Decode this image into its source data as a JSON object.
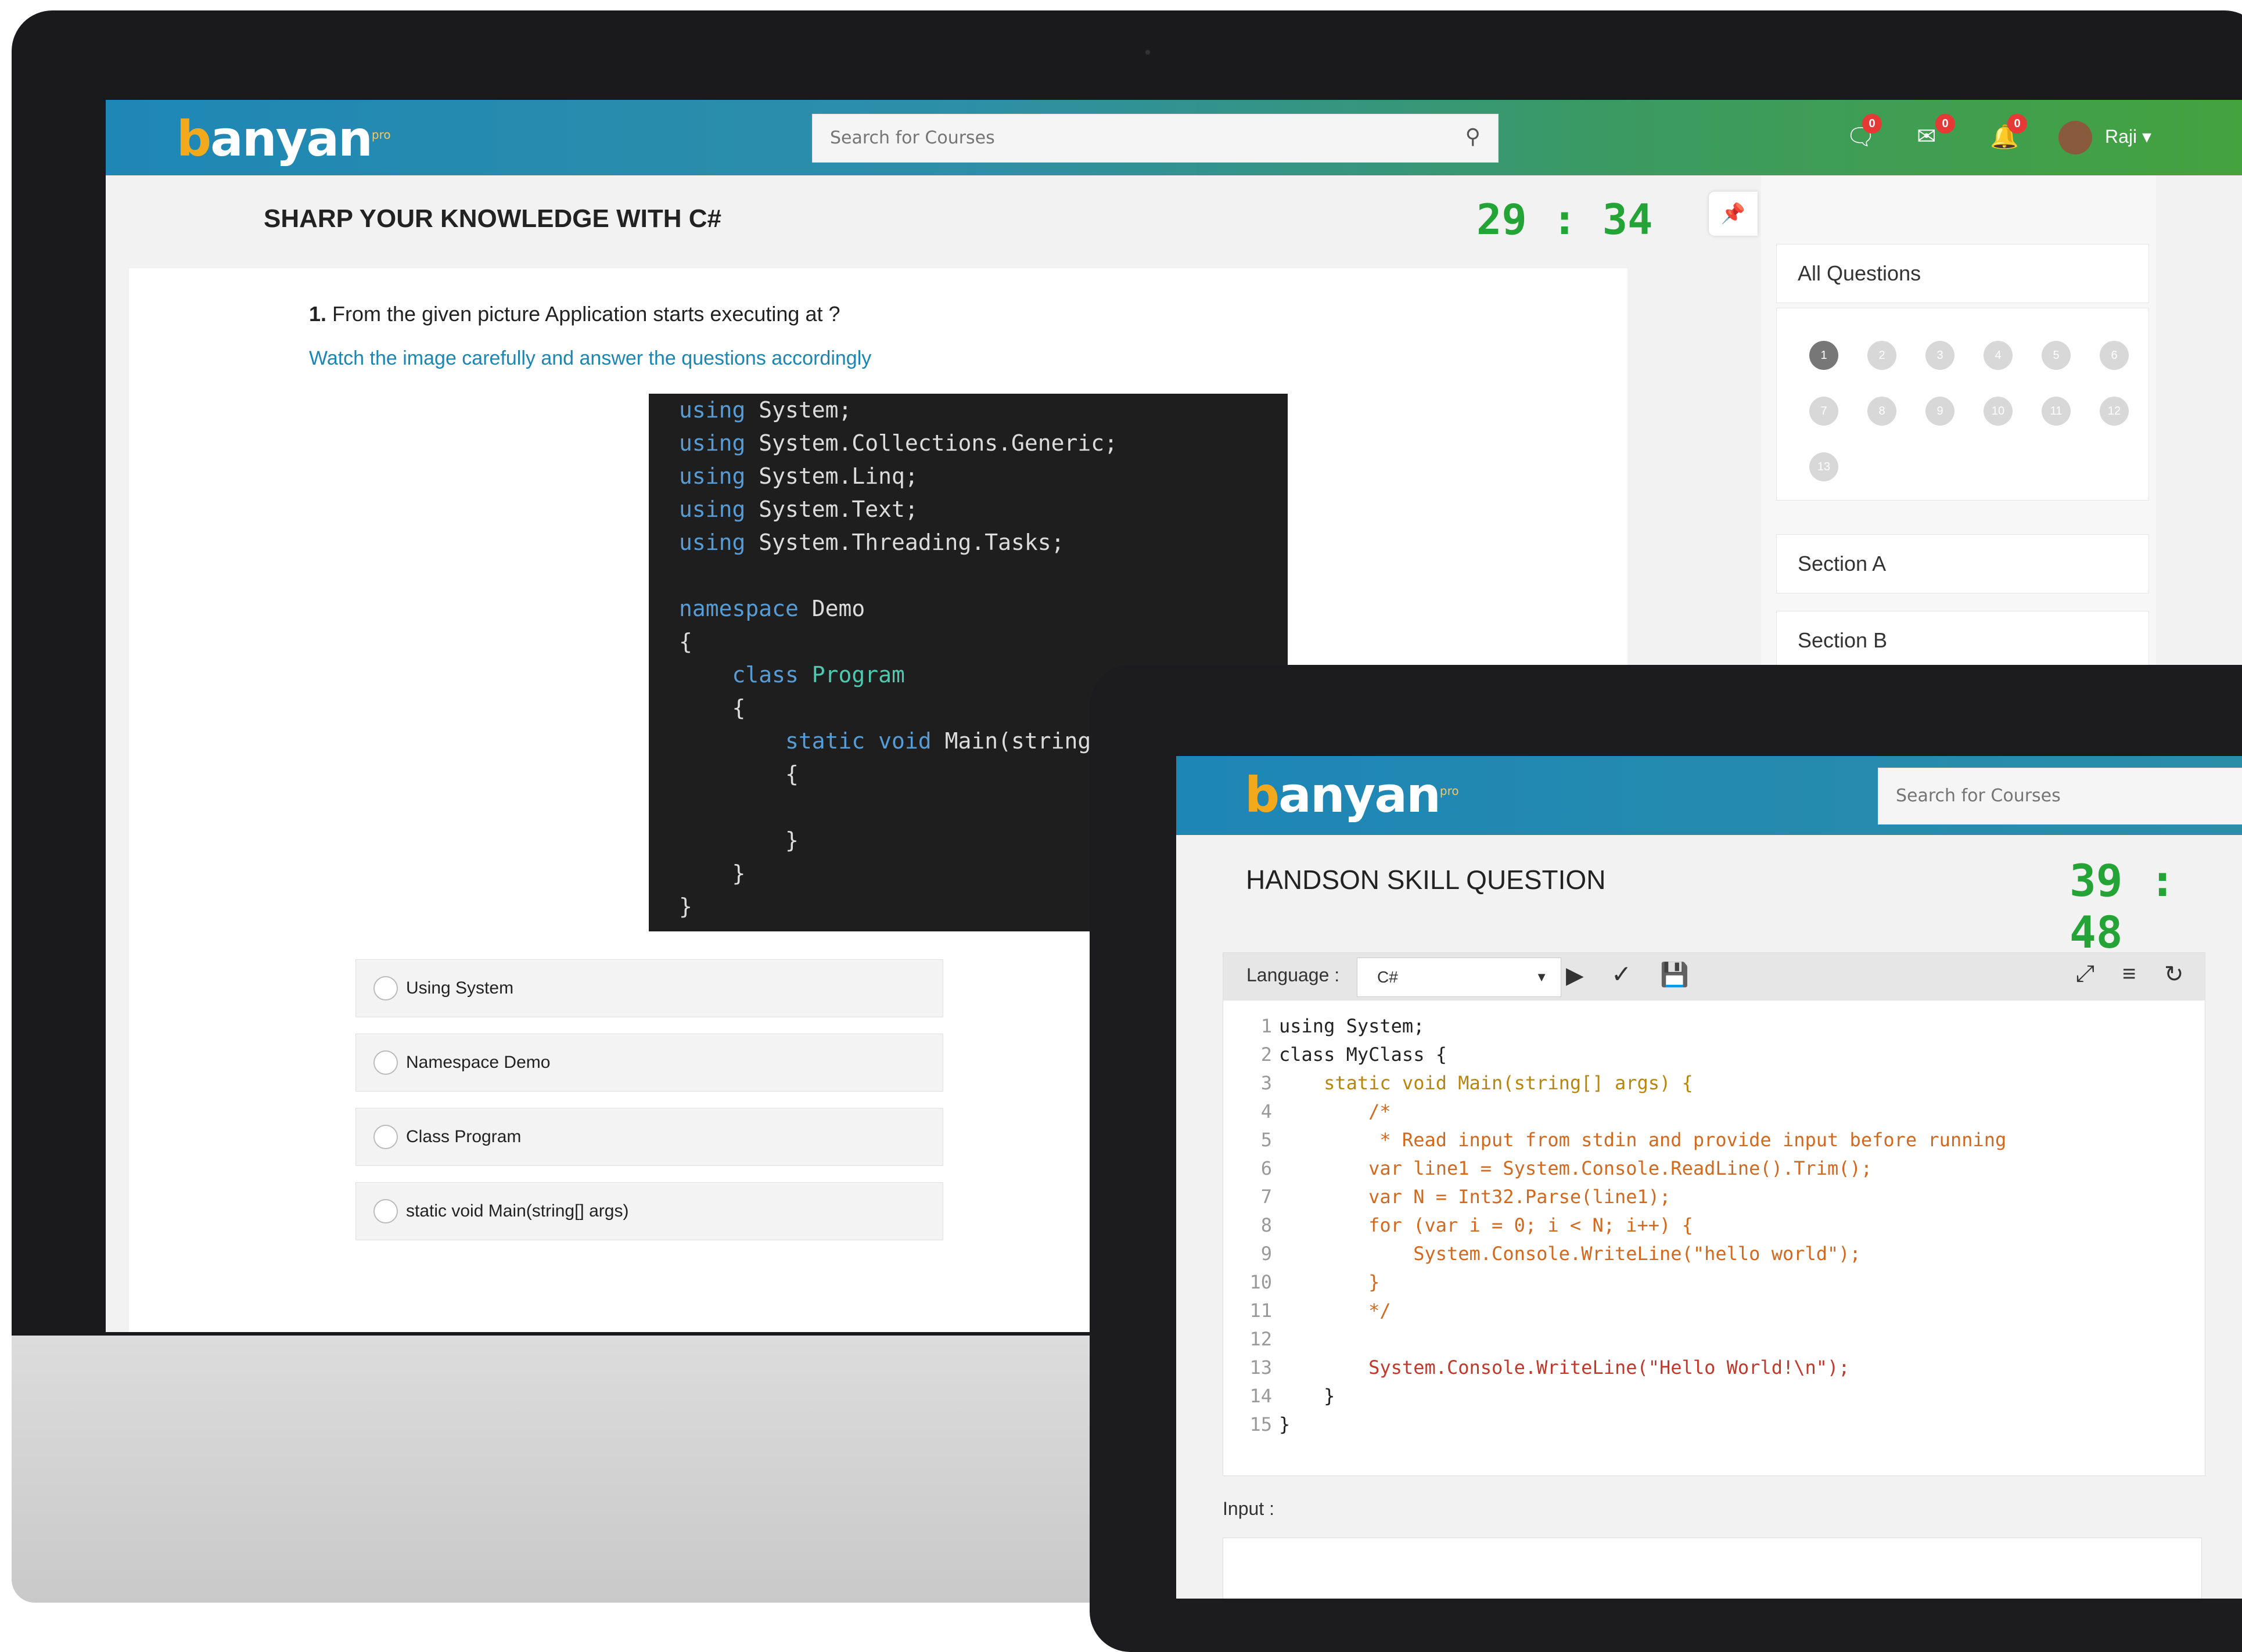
{
  "back_screen": {
    "logo": {
      "first": "b",
      "rest": "anyan",
      "sup": "pro"
    },
    "search": {
      "placeholder": "Search for Courses"
    },
    "badges": {
      "chat": "0",
      "mail": "0",
      "bell": "0"
    },
    "user": {
      "name": "Raji"
    },
    "page_title": "SHARP YOUR KNOWLEDGE WITH C#",
    "timer": "29 : 34",
    "question": {
      "number": "1.",
      "text": "From the given picture Application starts executing at ?",
      "hint": "Watch the image carefully and answer the questions accordingly",
      "code_lines": [
        {
          "kw": "using",
          "rest": " System;"
        },
        {
          "kw": "using",
          "rest": " System.Collections.Generic;"
        },
        {
          "kw": "using",
          "rest": " System.Linq;"
        },
        {
          "kw": "using",
          "rest": " System.Text;"
        },
        {
          "kw": "using",
          "rest": " System.Threading.Tasks;"
        },
        {
          "kw": "",
          "rest": ""
        },
        {
          "kw": "namespace",
          "rest": " Demo"
        },
        {
          "kw": "",
          "rest": "{"
        },
        {
          "kw": "    class",
          "rest": " Program",
          "cls": true
        },
        {
          "kw": "",
          "rest": "    {"
        },
        {
          "kw": "        static void",
          "rest": " Main(string"
        },
        {
          "kw": "",
          "rest": "        {"
        },
        {
          "kw": "",
          "rest": ""
        },
        {
          "kw": "",
          "rest": "        }"
        },
        {
          "kw": "",
          "rest": "    }"
        },
        {
          "kw": "",
          "rest": "}"
        }
      ],
      "options": [
        "Using System",
        "Namespace Demo",
        "Class Program",
        "static void Main(string[] args)"
      ]
    },
    "side": {
      "all_questions": "All Questions",
      "numbers": [
        "1",
        "2",
        "3",
        "4",
        "5",
        "6",
        "7",
        "8",
        "9",
        "10",
        "11",
        "12",
        "13"
      ],
      "sections": [
        "Section A",
        "Section B"
      ]
    }
  },
  "front_screen": {
    "logo": {
      "first": "b",
      "rest": "anyan",
      "sup": "pro"
    },
    "search": {
      "placeholder": "Search for Courses"
    },
    "page_title": "HANDSON SKILL QUESTION",
    "timer": "39 : 48",
    "editor": {
      "language_label": "Language :",
      "language_value": "C#",
      "code": [
        "using System;",
        "class MyClass {",
        "    static void Main(string[] args) {",
        "        /*",
        "         * Read input from stdin and provide input before running",
        "        var line1 = System.Console.ReadLine().Trim();",
        "        var N = Int32.Parse(line1);",
        "        for (var i = 0; i < N; i++) {",
        "            System.Console.WriteLine(\"hello world\");",
        "        }",
        "        */",
        "",
        "        System.Console.WriteLine(\"Hello World!\\n\");",
        "    }",
        "}"
      ]
    },
    "input_label": "Input :"
  }
}
